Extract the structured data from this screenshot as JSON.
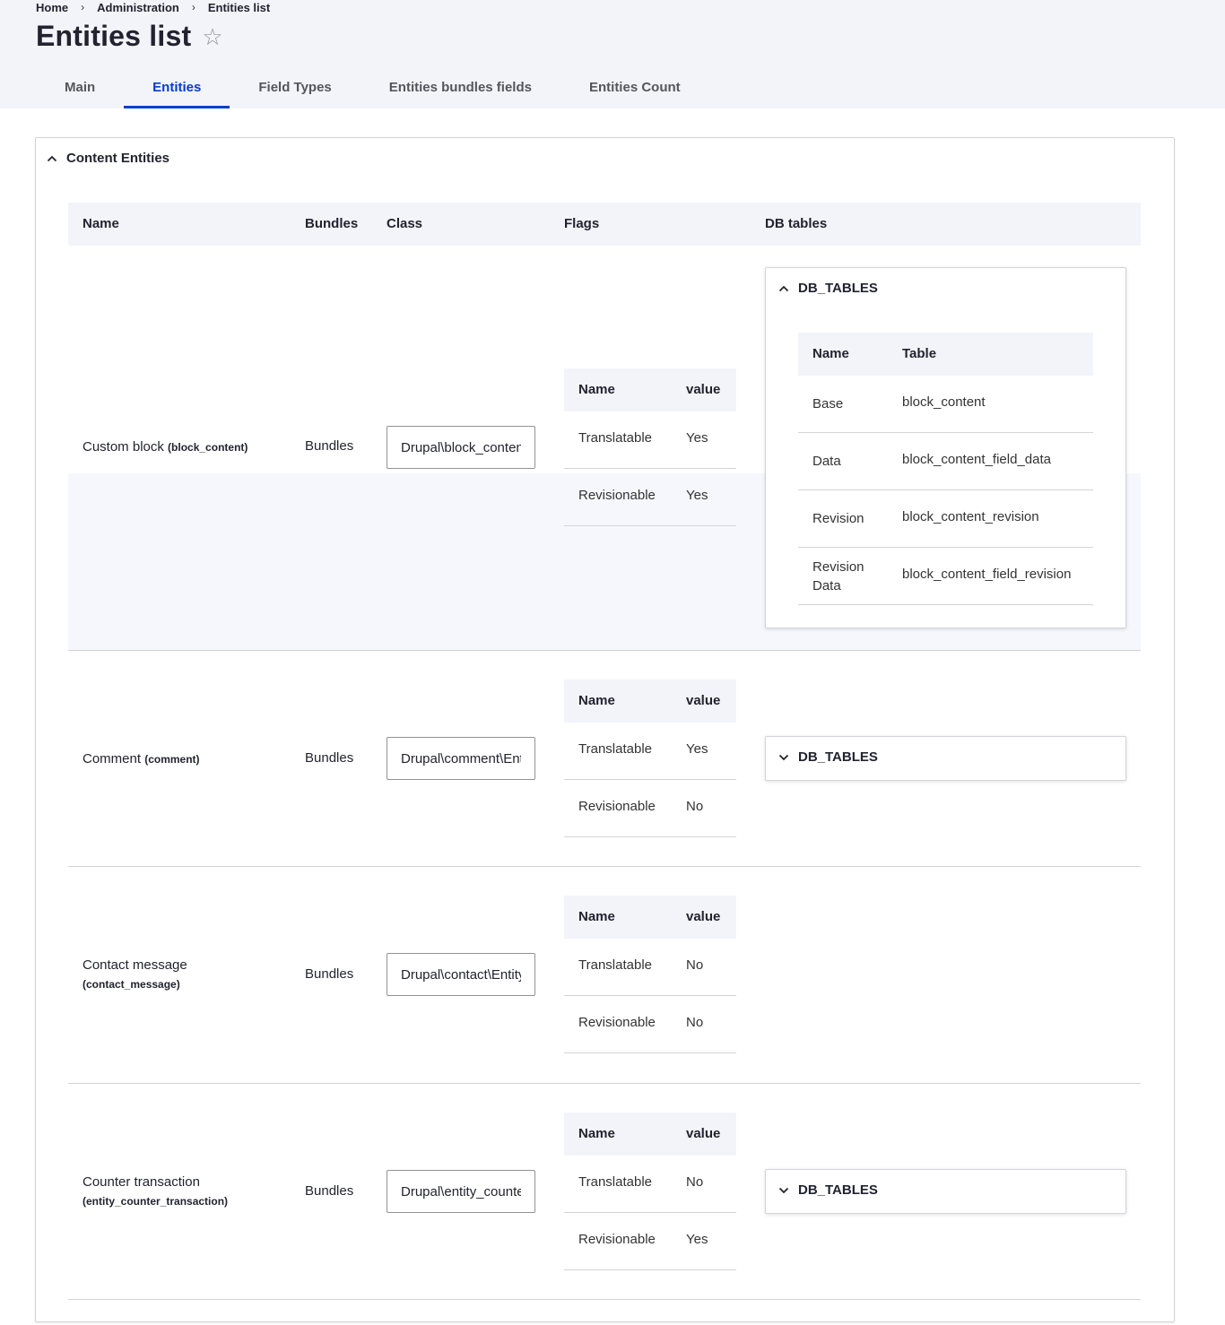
{
  "breadcrumb": {
    "home": "Home",
    "admin": "Administration",
    "current": "Entities list",
    "separator": "›"
  },
  "page": {
    "title": "Entities list",
    "favorite_icon": "☆"
  },
  "tabs": [
    {
      "label": "Main",
      "active": false
    },
    {
      "label": "Entities",
      "active": true
    },
    {
      "label": "Field Types",
      "active": false
    },
    {
      "label": "Entities bundles fields",
      "active": false
    },
    {
      "label": "Entities Count",
      "active": false
    }
  ],
  "section": {
    "summary": "Content Entities",
    "open": true
  },
  "table": {
    "headers": {
      "name": "Name",
      "bundles": "Bundles",
      "class": "Class",
      "flags": "Flags",
      "db_tables": "DB tables"
    },
    "flags_headers": {
      "name": "Name",
      "value": "value"
    },
    "db_headers": {
      "name": "Name",
      "table": "Table"
    },
    "db_summary": "DB_TABLES",
    "rows": [
      {
        "name": "Custom block",
        "machine": "(block_content)",
        "bundles": "Bundles",
        "class": "Drupal\\block_content\\Entity\\BlockContent",
        "flags": [
          {
            "name": "Translatable",
            "value": "Yes"
          },
          {
            "name": "Revisionable",
            "value": "Yes"
          }
        ],
        "db_open": true,
        "db_tables": [
          {
            "name": "Base",
            "table": "block_content"
          },
          {
            "name": "Data",
            "table": "block_content_field_data"
          },
          {
            "name": "Revision",
            "table": "block_content_revision"
          },
          {
            "name": "Revision Data",
            "table": "block_content_field_revision"
          }
        ]
      },
      {
        "name": "Comment",
        "machine": "(comment)",
        "bundles": "Bundles",
        "class": "Drupal\\comment\\Entity\\Comment",
        "flags": [
          {
            "name": "Translatable",
            "value": "Yes"
          },
          {
            "name": "Revisionable",
            "value": "No"
          }
        ],
        "db_open": false
      },
      {
        "name": "Contact message",
        "machine": "(contact_message)",
        "bundles": "Bundles",
        "class": "Drupal\\contact\\Entity\\Message",
        "flags": [
          {
            "name": "Translatable",
            "value": "No"
          },
          {
            "name": "Revisionable",
            "value": "No"
          }
        ]
      },
      {
        "name": "Counter transaction",
        "machine": "(entity_counter_transaction)",
        "bundles": "Bundles",
        "class": "Drupal\\entity_counter\\Entity\\CounterTransaction",
        "flags": [
          {
            "name": "Translatable",
            "value": "No"
          },
          {
            "name": "Revisionable",
            "value": "Yes"
          }
        ],
        "db_open": false
      }
    ]
  }
}
